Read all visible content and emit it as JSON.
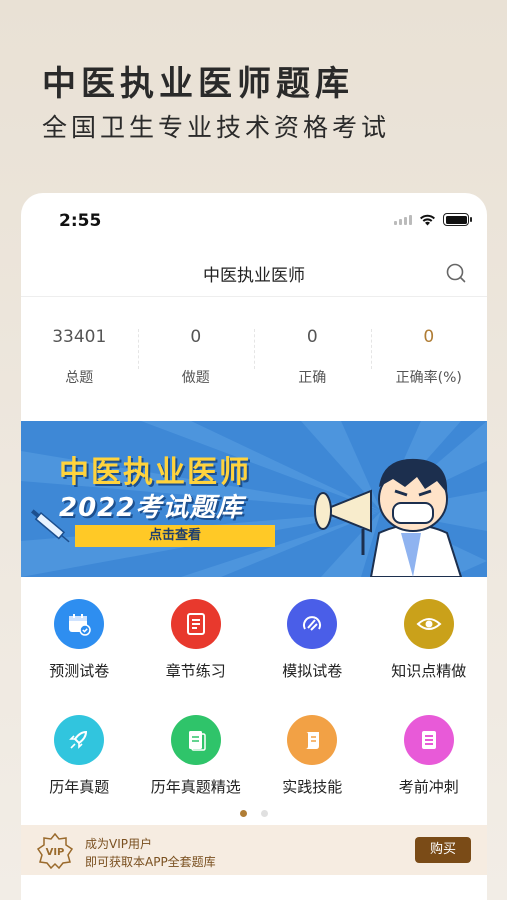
{
  "promo": {
    "title": "中医执业医师题库",
    "subtitle": "全国卫生专业技术资格考试"
  },
  "status_bar": {
    "time": "2:55"
  },
  "nav": {
    "title": "中医执业医师",
    "search_icon": "search-icon"
  },
  "stats": [
    {
      "value": "33401",
      "label": "总题"
    },
    {
      "value": "0",
      "label": "做题"
    },
    {
      "value": "0",
      "label": "正确"
    },
    {
      "value": "0",
      "label": "正确率(%)"
    }
  ],
  "banner": {
    "title": "中医执业医师",
    "subtitle": "2022考试题库",
    "button": "点击查看"
  },
  "grid": [
    {
      "label": "预测试卷",
      "icon": "calendar-check-icon",
      "color": "#2e8ef0"
    },
    {
      "label": "章节练习",
      "icon": "clipboard-icon",
      "color": "#e8392d"
    },
    {
      "label": "模拟试卷",
      "icon": "exam-icon",
      "color": "#4a5ee8"
    },
    {
      "label": "知识点精做",
      "icon": "eye-icon",
      "color": "#caa11a"
    },
    {
      "label": "历年真题",
      "icon": "rocket-icon",
      "color": "#31c5de"
    },
    {
      "label": "历年真题精选",
      "icon": "document-icon",
      "color": "#2fc46a"
    },
    {
      "label": "实践技能",
      "icon": "scroll-icon",
      "color": "#f2a145"
    },
    {
      "label": "考前冲刺",
      "icon": "list-icon",
      "color": "#e85ad8"
    }
  ],
  "vip": {
    "badge": "VIP",
    "line1": "成为VIP用户",
    "line2": "即可获取本APP全套题库",
    "buy": "购买"
  }
}
